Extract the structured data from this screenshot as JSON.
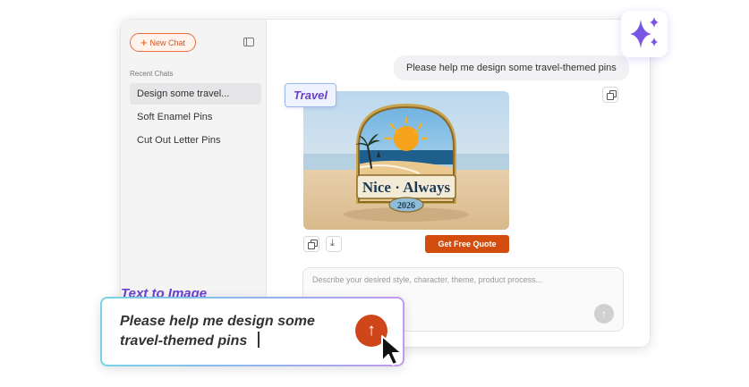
{
  "sidebar": {
    "new_chat_label": "New Chat",
    "new_chat_icon": "plus-icon",
    "toggle_icon": "sidebar-toggle-icon",
    "recent_label": "Recent Chats",
    "items": [
      {
        "label": "Design some travel...",
        "active": true
      },
      {
        "label": "Soft Enamel Pins",
        "active": false
      },
      {
        "label": "Cut Out Letter Pins",
        "active": false
      }
    ]
  },
  "conversation": {
    "user_message": "Please help me design some travel-themed pins",
    "image_tag": "Travel",
    "pin": {
      "main_text": "Nice · Always",
      "year": "2026"
    },
    "actions": {
      "copy_icon": "copy-icon",
      "download_icon": "download-icon"
    },
    "quote_button": "Get Free Quote"
  },
  "prompt": {
    "placeholder": "Describe your desired style, character, theme, product process..."
  },
  "overlay": {
    "title": "Text to Image",
    "prompt_text": "Please help me design some travel-themed pins",
    "send_icon": "arrow-up-icon",
    "sparkle_icon": "sparkle-icon"
  },
  "colors": {
    "accent": "#d34d0e",
    "tag_text": "#6a3fc8",
    "title_purple": "#6c3fd0"
  }
}
